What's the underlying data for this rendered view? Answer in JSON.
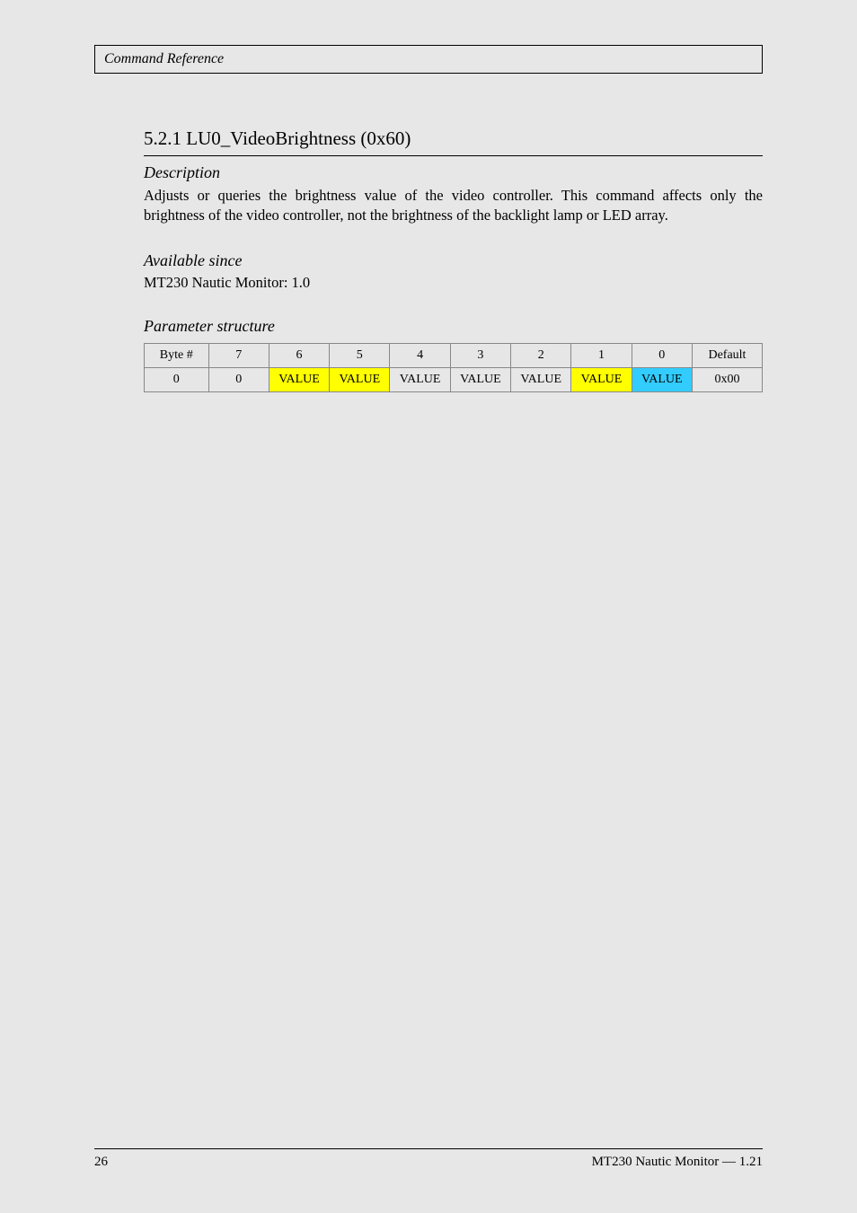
{
  "header": {
    "title": "Command Reference"
  },
  "section": {
    "number": "5.2.1",
    "title": "LU0_VideoBrightness (0x60)",
    "description_italic": "Description",
    "description": "Adjusts or queries the brightness value of the video controller. This command affects only the brightness of the video controller, not the brightness of the backlight lamp or LED array.",
    "since_label_italic": "Available since",
    "since_text": "MT230 Nautic Monitor: 1.0",
    "param_label_italic": "Parameter structure"
  },
  "table": {
    "headers": [
      "Byte #",
      "7",
      "6",
      "5",
      "4",
      "3",
      "2",
      "1",
      "0",
      "Default"
    ],
    "row": {
      "byte": "0",
      "b7": "0",
      "b6": "VALUE",
      "b5": "VALUE",
      "b4": "VALUE",
      "b3": "VALUE",
      "b2": "VALUE",
      "b1": "VALUE",
      "b0": "VALUE",
      "default": "0x00"
    }
  },
  "footer": {
    "page": "26",
    "doc": "MT230 Nautic Monitor — 1.21"
  }
}
